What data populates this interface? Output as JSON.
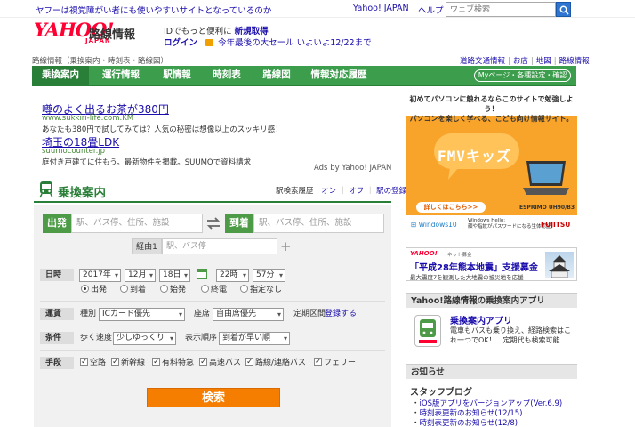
{
  "topbar": {
    "notice": "ヤフーは視覚障がい者にも使いやすいサイトとなっているのか",
    "yahoo_japan": "Yahoo! JAPAN",
    "help": "ヘルプ",
    "search_placeholder": "ウェブ検索"
  },
  "header": {
    "logo": "YAHOO!",
    "logo_sub": "JAPAN",
    "service_name": "路線情報",
    "promo_text": "IDでもっと便利に",
    "register": "新規取得",
    "login": "ログイン",
    "sale": "今年最後の大セール いよいよ12/22まで"
  },
  "breadcrumb": {
    "text": "路線情報（乗換案内・時刻表・路線図）",
    "right_links": [
      "道路交通情報",
      "お店",
      "地図",
      "路線情報"
    ]
  },
  "nav": {
    "tabs": [
      "乗換案内",
      "運行情報",
      "駅情報",
      "時刻表",
      "路線図",
      "情報対応履歴"
    ],
    "my_page": "Myページ・各種設定・確認"
  },
  "ads": [
    {
      "title": "噂のよく出るお茶が380円",
      "url": "www.sukkiri-life.com.KM",
      "desc": "あなたも380円で試してみては？人気の秘密は想像以上のスッキリ感！"
    },
    {
      "title": "埼玉の18畳LDK",
      "url": "suumocounter.jp",
      "desc": "庭付き戸建てに住もう。最新物件を掲載。SUUMOで資料請求"
    }
  ],
  "ads_by": "Ads by Yahoo! JAPAN",
  "transit": {
    "title": "乗換案内",
    "history_label": "駅検索履歴",
    "on": "オン",
    "off": "オフ",
    "register_station": "駅の登録",
    "from_label": "出発",
    "to_label": "到着",
    "from_placeholder": "駅、バス停、住所、施設",
    "to_placeholder": "駅、バス停、住所、施設",
    "via_label": "経由1",
    "via_placeholder": "駅、バス停",
    "datetime_label": "日時",
    "year": "2017年",
    "month": "12月",
    "day": "18日",
    "hour": "22時",
    "minute": "57分",
    "time_options": [
      "出発",
      "到着",
      "始発",
      "終電",
      "指定なし"
    ],
    "fare_label": "運賃",
    "fare_type_label": "種別",
    "fare_type": "ICカード優先",
    "seat_label": "座席",
    "seat": "自由席優先",
    "pass_label": "定期区間",
    "pass_register": "登録する",
    "cond_label": "条件",
    "speed_label": "歩く速度",
    "speed": "少しゆっくり",
    "order_label": "表示順序",
    "order": "到着が早い順",
    "means_label": "手段",
    "means": [
      "空路",
      "新幹線",
      "有料特急",
      "高速バス",
      "路線/連絡バス",
      "フェリー"
    ],
    "search_button": "検索"
  },
  "banner": {
    "headline1": "初めてパソコンに触れるならこのサイトで勉強しよう！",
    "headline2": "パソコンを楽しく学べる、こども向け情報サイト。",
    "brand": "FMVキッズ",
    "cta": "詳しくはこちら>>",
    "model": "ESPRIMO UH90/B3",
    "windows": "Windows10",
    "hello1": "Windows Hello:",
    "hello2": "顔や指紋がパスワードになる生体認証",
    "maker": "FUJITSU"
  },
  "charity": {
    "logo": "YAHOO!",
    "sub": "ネット募金",
    "title": "「平成28年熊本地震」支援募金",
    "desc": "最大震度7を観測した大地震の被災地を応援"
  },
  "app_section": {
    "heading": "Yahoo!路線情報の乗換案内アプリ",
    "title": "乗換案内アプリ",
    "desc": "電車もバスも乗り換え、経路検索はこれ一つでOK！　定期代も検索可能"
  },
  "notice_section": {
    "heading": "お知らせ",
    "staff_blog": "スタッフブログ",
    "items": [
      "iOS版アプリをバージョンアップ(Ver.6.9)",
      "時刻表更新のお知らせ(12/15)",
      "時刻表更新のお知らせ(12/8)"
    ]
  },
  "colors": {
    "nav_green": "#3c9d4c",
    "label_green": "#4d9b46",
    "search_orange": "#f57d00",
    "yahoo_red": "#ff0033",
    "link_blue": "#1a0dab"
  }
}
